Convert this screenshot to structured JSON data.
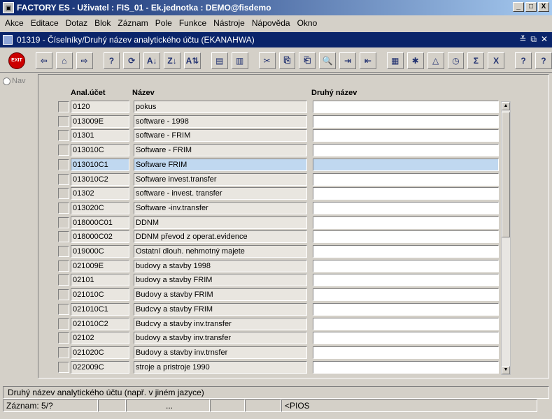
{
  "app": {
    "title": "FACTORY ES - Uživatel : FIS_01 - Ek.jednotka : DEMO@fisdemo",
    "window_controls": [
      "_",
      "□",
      "X"
    ]
  },
  "menu": [
    {
      "label": "Akce"
    },
    {
      "label": "Editace"
    },
    {
      "label": "Dotaz"
    },
    {
      "label": "Blok"
    },
    {
      "label": "Záznam"
    },
    {
      "label": "Pole"
    },
    {
      "label": "Funkce"
    },
    {
      "label": "Nástroje"
    },
    {
      "label": "Nápověda"
    },
    {
      "label": "Okno"
    }
  ],
  "form": {
    "title": "01319 - Číselníky/Druhý název analytického účtu (EKANAHWA)",
    "controls": [
      "≚",
      "⧉",
      "✕"
    ]
  },
  "toolbar": {
    "exit_label": "EXIT",
    "buttons": [
      "⇦",
      "⌂",
      "⇨",
      "?",
      "⟳",
      "A↓",
      "Z↓",
      "A⇅",
      "▤",
      "▥",
      "✂",
      "⎘",
      "⎗",
      "🔍",
      "⇥",
      "⇤",
      "▦",
      "✱",
      "△",
      "◷",
      "Σ",
      "X",
      "?",
      "?"
    ]
  },
  "nav": {
    "label": "Nav"
  },
  "columns": {
    "acct": "Anal.účet",
    "name": "Název",
    "second": "Druhý název"
  },
  "rows": [
    {
      "acct": "0120",
      "name": "pokus",
      "second": ""
    },
    {
      "acct": "013009E",
      "name": "software - 1998",
      "second": ""
    },
    {
      "acct": "01301",
      "name": "software - FRIM",
      "second": ""
    },
    {
      "acct": "013010C",
      "name": "Software - FRIM",
      "second": ""
    },
    {
      "acct": "013010C1",
      "name": "Software FRIM",
      "second": ""
    },
    {
      "acct": "013010C2",
      "name": "Software invest.transfer",
      "second": ""
    },
    {
      "acct": "01302",
      "name": "software - invest. transfer",
      "second": ""
    },
    {
      "acct": "013020C",
      "name": "Software -inv.transfer",
      "second": ""
    },
    {
      "acct": "018000C01",
      "name": "DDNM",
      "second": ""
    },
    {
      "acct": "018000C02",
      "name": "DDNM převod z operat.evidence",
      "second": ""
    },
    {
      "acct": "019000C",
      "name": "Ostatní dlouh. nehmotný majete",
      "second": ""
    },
    {
      "acct": "021009E",
      "name": "budovy a stavby 1998",
      "second": ""
    },
    {
      "acct": "02101",
      "name": "budovy a stavby FRIM",
      "second": ""
    },
    {
      "acct": "021010C",
      "name": "Budovy a stavby FRIM",
      "second": ""
    },
    {
      "acct": "021010C1",
      "name": "Budcvy a stavby FRIM",
      "second": ""
    },
    {
      "acct": "021010C2",
      "name": "Budcvy a stavby inv.transfer",
      "second": ""
    },
    {
      "acct": "02102",
      "name": "budovy a stavby inv.transfer",
      "second": ""
    },
    {
      "acct": "021020C",
      "name": "Budovy a stavby inv.trnsfer",
      "second": ""
    },
    {
      "acct": "022009C",
      "name": "stroje a pristroje 1990",
      "second": ""
    }
  ],
  "status": {
    "hint": "Druhý název analytického účtu (např. v jiném jazyce)",
    "record": "Záznam: 5/?",
    "dots": "...",
    "mode": "<PIOS"
  }
}
